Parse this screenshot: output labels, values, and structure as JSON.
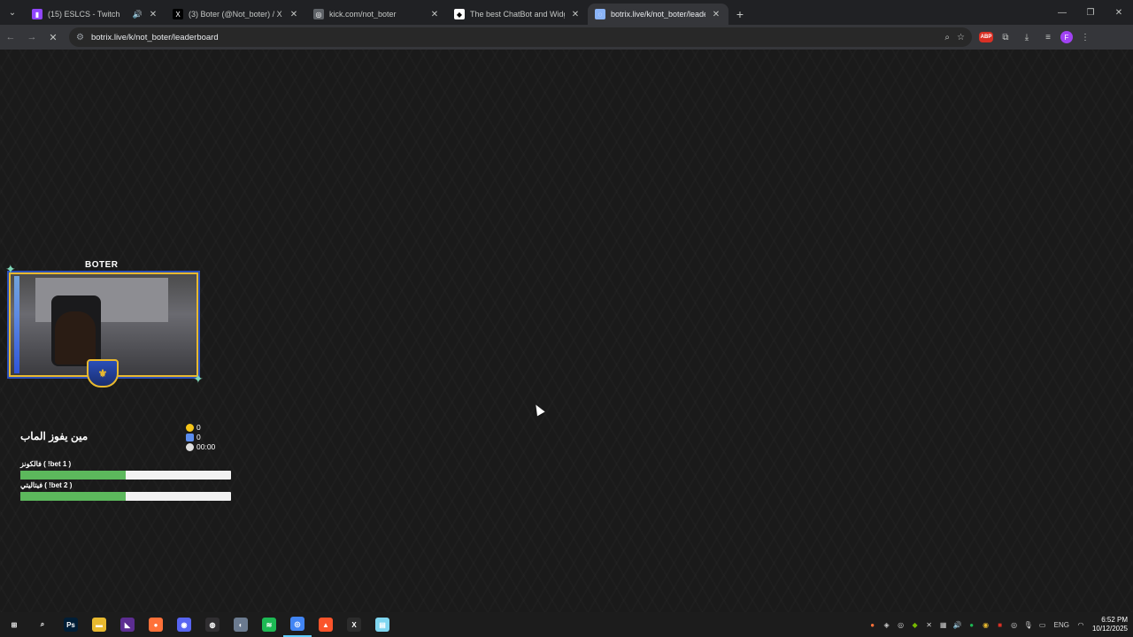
{
  "tabs": [
    {
      "title": "(15) ESLCS - Twitch",
      "icon": "twitch-icon",
      "color": "#9146ff",
      "glyph": "▮",
      "audio": true
    },
    {
      "title": "(3) Boter (@Not_boter) / X",
      "icon": "x-icon",
      "color": "#000000",
      "glyph": "X",
      "audio": false
    },
    {
      "title": "kick.com/not_boter",
      "icon": "globe-icon",
      "color": "#5f6368",
      "glyph": "◎",
      "audio": false
    },
    {
      "title": "The best ChatBot and Widgets",
      "icon": "botrix-icon",
      "color": "#ffffff",
      "glyph": "◆",
      "audio": false
    },
    {
      "title": "botrix.live/k/not_boter/leaderb",
      "icon": "loading-icon",
      "color": "#8ab4f8",
      "glyph": "◌",
      "audio": false,
      "active": true
    }
  ],
  "address": {
    "url": "botrix.live/k/not_boter/leaderboard"
  },
  "profile_initial": "F",
  "abp_label": "ABP",
  "overlay": {
    "streamer_name": "BOTER",
    "bet": {
      "title": "مين يفوز الماب",
      "coins": "0",
      "users": "0",
      "timer": "00:00",
      "options": [
        {
          "label": "فالكونز ( !bet 1 )",
          "fraction": 0.5
        },
        {
          "label": "فيتاليتي ( !bet 2 )",
          "fraction": 0.5
        }
      ]
    }
  },
  "taskbar": {
    "apps": [
      {
        "name": "start-icon",
        "glyph": "⊞",
        "color": "transparent"
      },
      {
        "name": "search-icon",
        "glyph": "⌕",
        "color": "transparent"
      },
      {
        "name": "photoshop-icon",
        "glyph": "Ps",
        "color": "#001e36"
      },
      {
        "name": "file-explorer-icon",
        "glyph": "▬",
        "color": "#e8b92f"
      },
      {
        "name": "visual-studio-icon",
        "glyph": "◣",
        "color": "#5c2d91"
      },
      {
        "name": "firefox-icon",
        "glyph": "●",
        "color": "#ff7139"
      },
      {
        "name": "discord-icon",
        "glyph": "◉",
        "color": "#5865f2"
      },
      {
        "name": "obs-icon",
        "glyph": "◍",
        "color": "#302e31"
      },
      {
        "name": "steam-icon",
        "glyph": "◐",
        "color": "#6b7a8f"
      },
      {
        "name": "spotify-icon",
        "glyph": "≋",
        "color": "#1db954"
      },
      {
        "name": "chrome-icon",
        "glyph": "◎",
        "color": "#4285f4",
        "active": true
      },
      {
        "name": "brave-icon",
        "glyph": "▲",
        "color": "#fb542b"
      },
      {
        "name": "excel-icon",
        "glyph": "X",
        "color": "#2b2b2b"
      },
      {
        "name": "notepad-icon",
        "glyph": "▤",
        "color": "#7fd6f0"
      }
    ],
    "lang": "ENG",
    "time": "6:52 PM",
    "date": "10/12/2025"
  }
}
